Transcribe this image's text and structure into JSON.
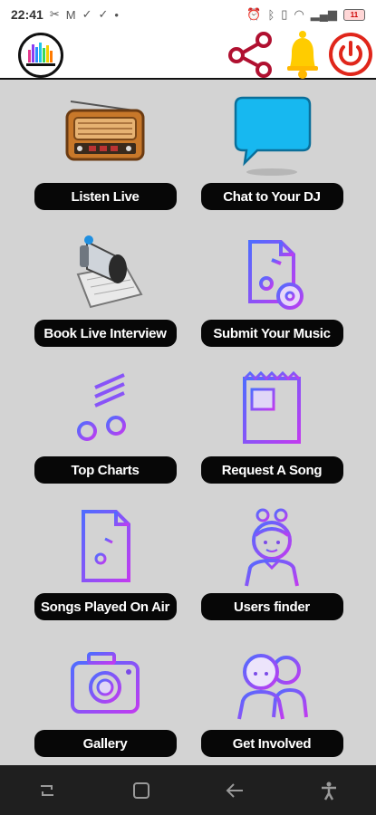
{
  "status_bar": {
    "time": "22:41",
    "battery": "11"
  },
  "tiles": [
    {
      "label": "Listen Live",
      "icon": "radio-icon"
    },
    {
      "label": "Chat to Your DJ",
      "icon": "chat-bubble-icon"
    },
    {
      "label": "Book Live Interview",
      "icon": "megaphone-notebook-icon"
    },
    {
      "label": "Submit Your Music",
      "icon": "music-file-icon"
    },
    {
      "label": "Top Charts",
      "icon": "music-notes-icon"
    },
    {
      "label": "Request A Song",
      "icon": "newspaper-icon"
    },
    {
      "label": "Songs Played On Air",
      "icon": "audio-document-icon"
    },
    {
      "label": "Users finder",
      "icon": "user-girl-icon"
    },
    {
      "label": "Gallery",
      "icon": "camera-icon"
    },
    {
      "label": "Get Involved",
      "icon": "group-people-icon"
    }
  ],
  "colors": {
    "background": "#d3d3d3",
    "pill": "#070707",
    "accent_gradient_start": "#4f6cff",
    "accent_gradient_end": "#c13bf0",
    "share_red": "#b01030",
    "bell_yellow": "#ffcc00",
    "power_red": "#e0261b",
    "navbar": "#1f1f1f"
  }
}
